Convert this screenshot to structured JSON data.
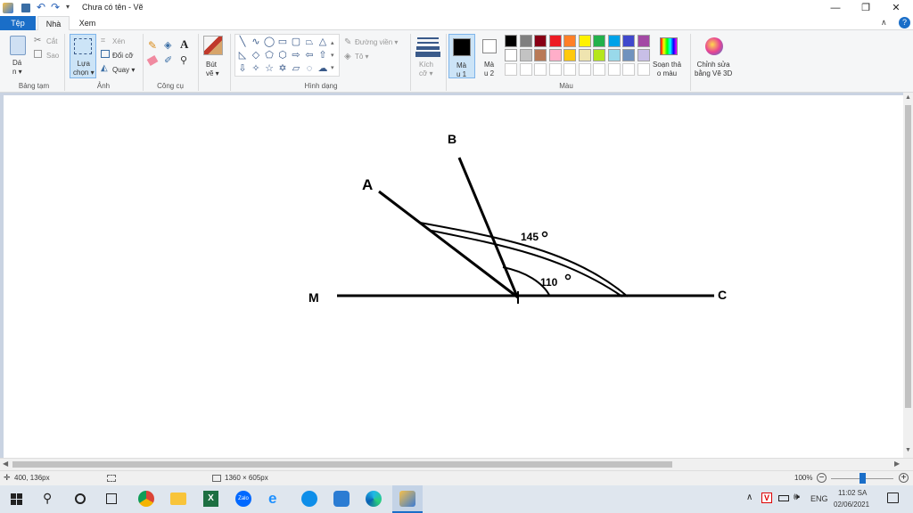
{
  "titlebar": {
    "title": "Chưa có tên - Vẽ"
  },
  "tabs": [
    "Tệp",
    "Nhà",
    "Xem"
  ],
  "ribbon": {
    "clipboard": {
      "paste": "Dá\nn ▾",
      "cut": "Cắt",
      "copy": "Sao",
      "label": "Bảng tạm"
    },
    "image": {
      "select": "Lựa\nchọn ▾",
      "crop": "Xén",
      "resize": "Đổi cỡ",
      "rotate": "Quay ▾",
      "label": "Ảnh"
    },
    "tools": {
      "label": "Công cụ"
    },
    "brushes": {
      "text": "Bút\nvẽ ▾"
    },
    "shapes": {
      "outline": "Đường viền ▾",
      "fill": "Tô ▾",
      "label": "Hình dạng"
    },
    "size": {
      "text": "Kích\ncỡ ▾"
    },
    "color1": {
      "text": "Mà\nu 1"
    },
    "color2": {
      "text": "Mà\nu 2"
    },
    "colors": {
      "label": "Màu"
    },
    "edit_colors": {
      "text": "Soạn thả\no màu"
    },
    "paint3d": {
      "text": "Chỉnh sửa\nbằng Vẽ 3D"
    }
  },
  "palette_row1": [
    "#000000",
    "#7f7f7f",
    "#880015",
    "#ed1c24",
    "#ff7f27",
    "#fff200",
    "#22b14c",
    "#00a2e8",
    "#3f48cc",
    "#a349a4"
  ],
  "palette_row2": [
    "#ffffff",
    "#c3c3c3",
    "#b97a57",
    "#ffaec9",
    "#ffc90e",
    "#efe4b0",
    "#b5e61d",
    "#99d9ea",
    "#7092be",
    "#c8bfe7"
  ],
  "drawing": {
    "labels": {
      "B": "B",
      "A": "A",
      "M": "M",
      "C": "C",
      "angle1": "145",
      "angle2": "110"
    }
  },
  "status": {
    "position": "400, 136px",
    "canvas_size": "1360 × 605px",
    "zoom": "100%"
  },
  "taskbar": {
    "lang": "ENG",
    "time": "11:02 SA",
    "date": "02/06/2021"
  }
}
